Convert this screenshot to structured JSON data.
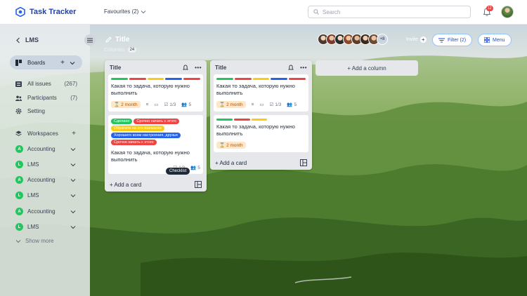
{
  "app": {
    "name": "Task Tracker",
    "brand_color": "#1e40af"
  },
  "topbar": {
    "favourites_label": "Favourites (2)",
    "search_placeholder": "Search",
    "notification_count": "12"
  },
  "sidebar": {
    "project": "LMS",
    "boards_label": "Boards",
    "items": [
      {
        "label": "All issues",
        "count": "(267)",
        "icon": "list-icon"
      },
      {
        "label": "Participants",
        "count": "(7)",
        "icon": "users-icon"
      },
      {
        "label": "Setting",
        "count": "",
        "icon": "gear-icon"
      }
    ],
    "workspaces_label": "Workspaces",
    "workspaces": [
      {
        "initial": "A",
        "label": "Accounting"
      },
      {
        "initial": "L",
        "label": "LMS"
      },
      {
        "initial": "A",
        "label": "Accounting"
      },
      {
        "initial": "L",
        "label": "LMS"
      },
      {
        "initial": "A",
        "label": "Accounting"
      },
      {
        "initial": "L",
        "label": "LMS"
      }
    ],
    "show_more": "Show more"
  },
  "board": {
    "title": "Title",
    "columns_label": "Columns",
    "columns_count": "24",
    "members_more": "+8",
    "invite_label": "Invite",
    "filter_label": "Filter (2)",
    "menu_label": "Menu",
    "add_column_label": "+ Add a column",
    "add_card_label": "+ Add a card",
    "tooltip": "Checklist"
  },
  "colors": {
    "green": "#22c55e",
    "red": "#ef4444",
    "yellow": "#facc15",
    "blue": "#2563eb",
    "orange": "#f97316"
  },
  "columns": [
    {
      "title": "Title",
      "cards": [
        {
          "bars": [
            "#22c55e",
            "#ef4444",
            "#facc15",
            "#2563eb",
            "#ef4444"
          ],
          "text": "Какая то задача, которую нужно выполнить",
          "due": "2 month",
          "checklist": "1/3",
          "members": "5"
        },
        {
          "tags": [
            [
              {
                "text": "Сделано",
                "color": "#22c55e"
              },
              {
                "text": "Срочно начать с этого",
                "color": "#ef4444"
              }
            ],
            [
              {
                "text": "Обратите на это внимание",
                "color": "#facc15"
              }
            ],
            [
              {
                "text": "Хорошего всем настроения, друзья",
                "color": "#2563eb"
              }
            ],
            [
              {
                "text": "Срочно начать с этого",
                "color": "#ef4444"
              }
            ]
          ],
          "text": "Какая то задача, которую нужно выполнить",
          "checklist": "1/3",
          "members": "5"
        }
      ]
    },
    {
      "title": "Title",
      "cards": [
        {
          "bars": [
            "#22c55e",
            "#ef4444",
            "#facc15",
            "#2563eb",
            "#ef4444"
          ],
          "text": "Какая то задача, которую нужно выполнить",
          "due": "2 month",
          "checklist": "1/3",
          "members": "5"
        },
        {
          "bars": [
            "#22c55e",
            "#ef4444",
            "#facc15"
          ],
          "text": "Какая то задача, которую нужно выполнить",
          "due": "2 month"
        }
      ]
    }
  ]
}
